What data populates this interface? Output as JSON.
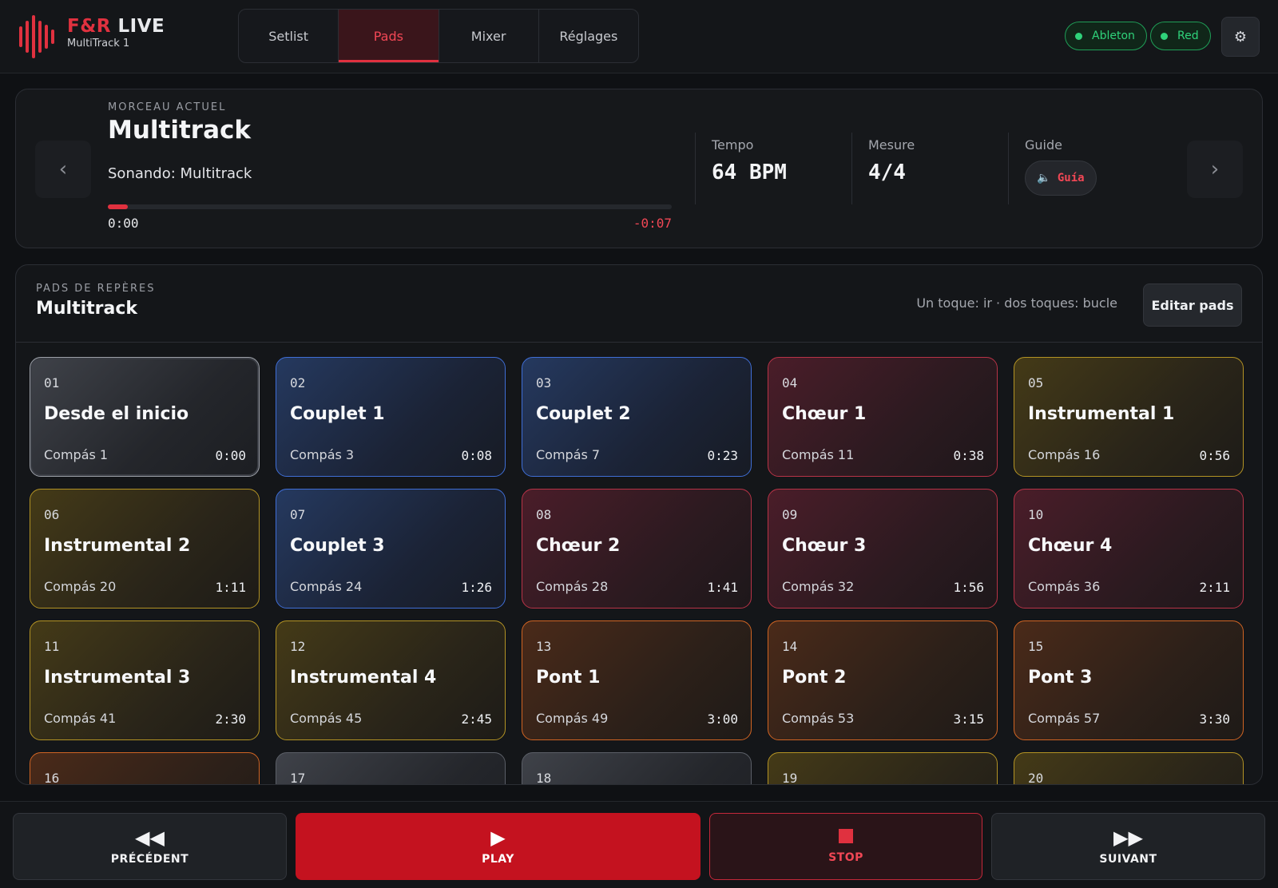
{
  "brand": {
    "name_part1": "F&R",
    "name_part2": "LIVE",
    "subtitle": "MultiTrack 1",
    "accent": "#e0313f"
  },
  "tabs": [
    {
      "label": "Setlist",
      "active": false
    },
    {
      "label": "Pads",
      "active": true
    },
    {
      "label": "Mixer",
      "active": false
    },
    {
      "label": "Réglages",
      "active": false
    }
  ],
  "status": [
    {
      "label": "Ableton",
      "color": "#2fd27a"
    },
    {
      "label": "Red",
      "color": "#2fd27a"
    }
  ],
  "settings_icon": "gear-icon",
  "now_playing": {
    "label": "MORCEAU ACTUEL",
    "title": "Multitrack",
    "playing": "Sonando: Multitrack",
    "progress": 0.035,
    "time_current": "0:00",
    "time_remaining": "-0:07",
    "tempo_label": "Tempo",
    "tempo_value": "64 BPM",
    "measure_label": "Mesure",
    "measure_value": "4/4",
    "guide_label": "Guide",
    "guide_button": "Guía"
  },
  "pads_panel": {
    "label": "PADS DE REPÈRES",
    "title": "Multitrack",
    "hint": "Un toque: ir · dos toques: bucle",
    "edit_button": "Editar pads",
    "pads": [
      {
        "num": "01",
        "name": "Desde el inicio",
        "bar": "Compás 1",
        "time": "0:00",
        "color": "gray",
        "selected": true
      },
      {
        "num": "02",
        "name": "Couplet 1",
        "bar": "Compás 3",
        "time": "0:08",
        "color": "blue"
      },
      {
        "num": "03",
        "name": "Couplet 2",
        "bar": "Compás 7",
        "time": "0:23",
        "color": "blue"
      },
      {
        "num": "04",
        "name": "Chœur 1",
        "bar": "Compás 11",
        "time": "0:38",
        "color": "red"
      },
      {
        "num": "05",
        "name": "Instrumental 1",
        "bar": "Compás 16",
        "time": "0:56",
        "color": "yellow"
      },
      {
        "num": "06",
        "name": "Instrumental 2",
        "bar": "Compás 20",
        "time": "1:11",
        "color": "yellow"
      },
      {
        "num": "07",
        "name": "Couplet 3",
        "bar": "Compás 24",
        "time": "1:26",
        "color": "blue"
      },
      {
        "num": "08",
        "name": "Chœur 2",
        "bar": "Compás 28",
        "time": "1:41",
        "color": "red"
      },
      {
        "num": "09",
        "name": "Chœur 3",
        "bar": "Compás 32",
        "time": "1:56",
        "color": "red"
      },
      {
        "num": "10",
        "name": "Chœur 4",
        "bar": "Compás 36",
        "time": "2:11",
        "color": "red"
      },
      {
        "num": "11",
        "name": "Instrumental 3",
        "bar": "Compás 41",
        "time": "2:30",
        "color": "yellow"
      },
      {
        "num": "12",
        "name": "Instrumental 4",
        "bar": "Compás 45",
        "time": "2:45",
        "color": "yellow"
      },
      {
        "num": "13",
        "name": "Pont 1",
        "bar": "Compás 49",
        "time": "3:00",
        "color": "orange"
      },
      {
        "num": "14",
        "name": "Pont 2",
        "bar": "Compás 53",
        "time": "3:15",
        "color": "orange"
      },
      {
        "num": "15",
        "name": "Pont 3",
        "bar": "Compás 57",
        "time": "3:30",
        "color": "orange"
      },
      {
        "num": "16",
        "name": "",
        "bar": "",
        "time": "",
        "color": "orange"
      },
      {
        "num": "17",
        "name": "",
        "bar": "",
        "time": "",
        "color": "gray"
      },
      {
        "num": "18",
        "name": "",
        "bar": "",
        "time": "",
        "color": "gray"
      },
      {
        "num": "19",
        "name": "",
        "bar": "",
        "time": "",
        "color": "yellow"
      },
      {
        "num": "20",
        "name": "",
        "bar": "",
        "time": "",
        "color": "yellow"
      }
    ]
  },
  "footer": {
    "prev": "PRÉCÉDENT",
    "play": "PLAY",
    "stop": "STOP",
    "next": "SUIVANT"
  }
}
